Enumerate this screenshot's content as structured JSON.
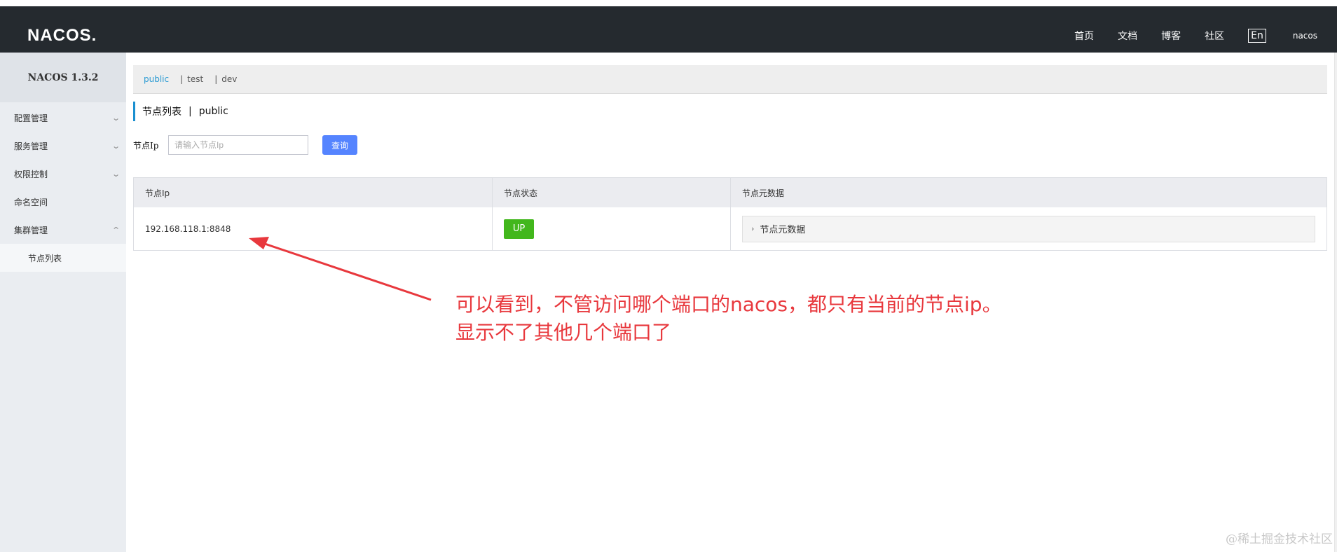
{
  "header": {
    "logo": "NACOS.",
    "nav": [
      "首页",
      "文档",
      "博客",
      "社区"
    ],
    "lang": "En",
    "user": "nacos"
  },
  "sidebar": {
    "version": "NACOS 1.3.2",
    "items": [
      {
        "label": "配置管理",
        "chevron": "down"
      },
      {
        "label": "服务管理",
        "chevron": "down"
      },
      {
        "label": "权限控制",
        "chevron": "down"
      },
      {
        "label": "命名空间",
        "chevron": ""
      },
      {
        "label": "集群管理",
        "chevron": "up"
      }
    ],
    "sub_items": [
      "节点列表"
    ]
  },
  "namespaces": {
    "items": [
      "public",
      "test",
      "dev"
    ],
    "separator": "|",
    "active": "public"
  },
  "page": {
    "title": "节点列表",
    "divider": "|",
    "namespace": "public"
  },
  "search": {
    "label": "节点Ip",
    "placeholder": "请输入节点Ip",
    "button": "查询"
  },
  "table": {
    "headers": [
      "节点Ip",
      "节点状态",
      "节点元数据"
    ],
    "rows": [
      {
        "ip": "192.168.118.1:8848",
        "status": "UP",
        "metadata": "节点元数据"
      }
    ]
  },
  "annotation": {
    "line1": "可以看到，不管访问哪个端口的nacos，都只有当前的节点ip。",
    "line2": "显示不了其他几个端口了",
    "color": "#e8383d"
  },
  "watermark": "@稀土掘金技术社区",
  "colors": {
    "topbar": "#252a2f",
    "accent": "#2b9bd3",
    "primary_button": "#5584ff",
    "status_up": "#42b71c"
  }
}
